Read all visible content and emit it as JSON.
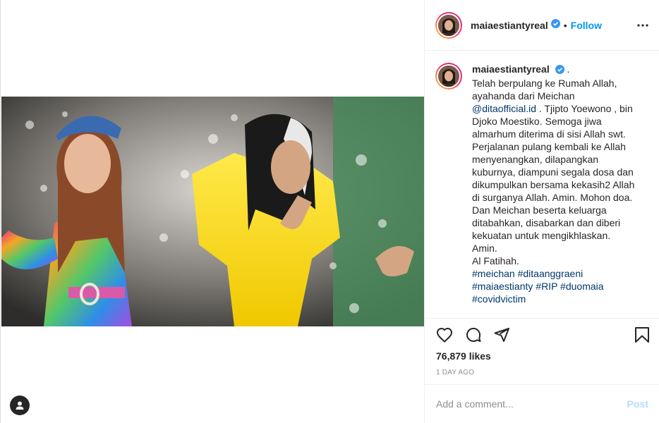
{
  "post": {
    "username": "maiaestiantyreal",
    "verified": true,
    "follow_label": "Follow",
    "dot": "•",
    "more_icon": "more-horizontal-icon"
  },
  "caption": {
    "username": "maiaestiantyreal",
    "trailing": ".",
    "lines": [
      "Telah berpulang ke Rumah Allah,",
      "ayahanda dari Meichan"
    ],
    "mention": "@ditaofficial.id",
    "after_mention": " . Tjipto Yoewono , bin",
    "lines2": [
      "Djoko Moestiko. Semoga jiwa",
      "almarhum diterima di sisi Allah swt.",
      "Perjalanan pulang kembali ke Allah",
      "menyenangkan, dilapangkan",
      "kuburnya, diampuni segala dosa dan",
      "dikumpulkan bersama kekasih2 Allah",
      "di surganya Allah. Amin. Mohon doa.",
      "Dan Meichan beserta keluarga",
      "ditabahkan, disabarkan dan diberi",
      "kekuatan untuk mengikhlaskan.",
      "Amin.",
      "Al Fatihah."
    ],
    "hashtags": [
      [
        "#meichan",
        "#ditaanggraeni"
      ],
      [
        "#maiaestianty",
        "#RIP",
        "#duomaia"
      ],
      [
        "#covidvictim"
      ]
    ]
  },
  "actions": {
    "like_icon": "heart-icon",
    "comment_icon": "comment-icon",
    "share_icon": "share-icon",
    "save_icon": "bookmark-icon",
    "likes_text": "76,879 likes",
    "timestamp": "1 DAY AGO"
  },
  "comment_form": {
    "placeholder": "Add a comment...",
    "post_label": "Post"
  },
  "colors": {
    "accent": "#0095f6",
    "link": "#00376b",
    "post_disabled": "#b3dbff",
    "muted": "#8e8e8e"
  }
}
